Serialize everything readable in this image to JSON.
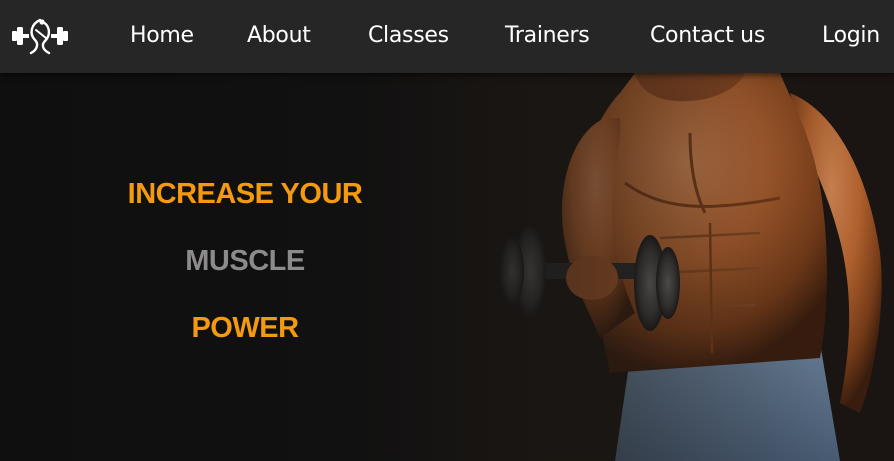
{
  "navbar": {
    "logo_icon": "fitness-dumbbell-logo-icon",
    "links": [
      {
        "label": "Home"
      },
      {
        "label": "About"
      },
      {
        "label": "Classes"
      },
      {
        "label": "Trainers"
      },
      {
        "label": "Contact us"
      },
      {
        "label": "Login"
      }
    ]
  },
  "hero": {
    "line1": "INCREASE YOUR",
    "line2": "MUSCLE",
    "line3": "POWER",
    "image_subject": "muscular-man-lifting-dumbbell"
  },
  "colors": {
    "accent": "#f39a0f",
    "muted": "#8c8a8a",
    "navbar_bg": "#262626",
    "hero_bg": "#0e0e0e"
  }
}
